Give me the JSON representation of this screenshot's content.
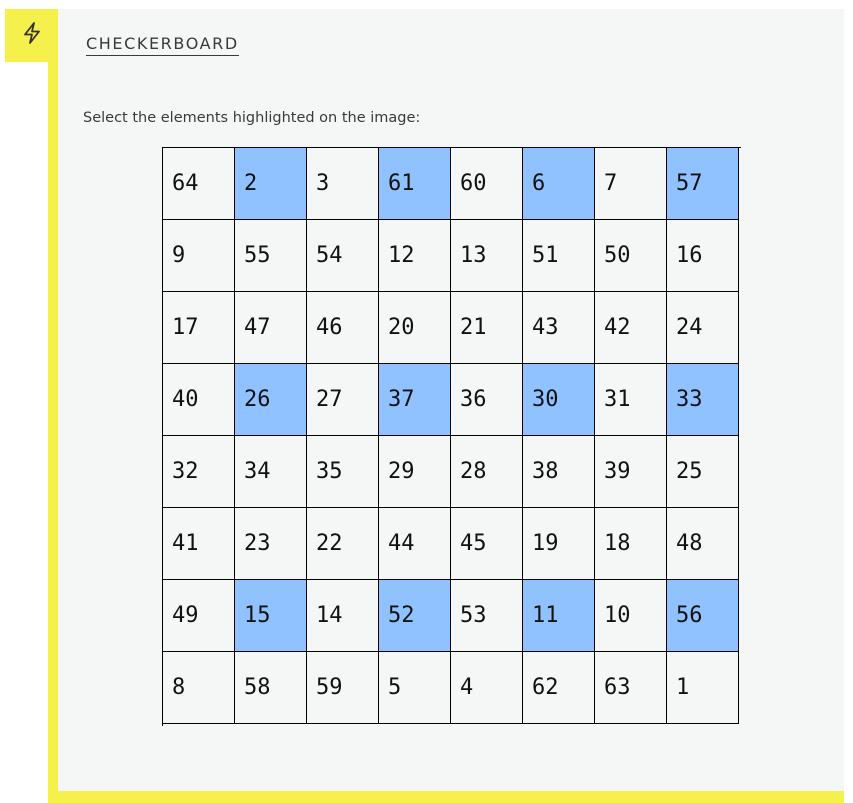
{
  "task": {
    "title": "CHECKERBOARD",
    "instruction": "Select the elements highlighted on the image:",
    "badge_icon": "lightning-bolt-icon"
  },
  "colors": {
    "accent": "#f5f04b",
    "highlight": "#8fc2ff",
    "panel": "#f5f6f6"
  },
  "board": {
    "rows": [
      [
        {
          "v": "64",
          "h": false
        },
        {
          "v": "2",
          "h": true
        },
        {
          "v": "3",
          "h": false
        },
        {
          "v": "61",
          "h": true
        },
        {
          "v": "60",
          "h": false
        },
        {
          "v": "6",
          "h": true
        },
        {
          "v": "7",
          "h": false
        },
        {
          "v": "57",
          "h": true
        }
      ],
      [
        {
          "v": "9",
          "h": false
        },
        {
          "v": "55",
          "h": false
        },
        {
          "v": "54",
          "h": false
        },
        {
          "v": "12",
          "h": false
        },
        {
          "v": "13",
          "h": false
        },
        {
          "v": "51",
          "h": false
        },
        {
          "v": "50",
          "h": false
        },
        {
          "v": "16",
          "h": false
        }
      ],
      [
        {
          "v": "17",
          "h": false
        },
        {
          "v": "47",
          "h": false
        },
        {
          "v": "46",
          "h": false
        },
        {
          "v": "20",
          "h": false
        },
        {
          "v": "21",
          "h": false
        },
        {
          "v": "43",
          "h": false
        },
        {
          "v": "42",
          "h": false
        },
        {
          "v": "24",
          "h": false
        }
      ],
      [
        {
          "v": "40",
          "h": false
        },
        {
          "v": "26",
          "h": true
        },
        {
          "v": "27",
          "h": false
        },
        {
          "v": "37",
          "h": true
        },
        {
          "v": "36",
          "h": false
        },
        {
          "v": "30",
          "h": true
        },
        {
          "v": "31",
          "h": false
        },
        {
          "v": "33",
          "h": true
        }
      ],
      [
        {
          "v": "32",
          "h": false
        },
        {
          "v": "34",
          "h": false
        },
        {
          "v": "35",
          "h": false
        },
        {
          "v": "29",
          "h": false
        },
        {
          "v": "28",
          "h": false
        },
        {
          "v": "38",
          "h": false
        },
        {
          "v": "39",
          "h": false
        },
        {
          "v": "25",
          "h": false
        }
      ],
      [
        {
          "v": "41",
          "h": false
        },
        {
          "v": "23",
          "h": false
        },
        {
          "v": "22",
          "h": false
        },
        {
          "v": "44",
          "h": false
        },
        {
          "v": "45",
          "h": false
        },
        {
          "v": "19",
          "h": false
        },
        {
          "v": "18",
          "h": false
        },
        {
          "v": "48",
          "h": false
        }
      ],
      [
        {
          "v": "49",
          "h": false
        },
        {
          "v": "15",
          "h": true
        },
        {
          "v": "14",
          "h": false
        },
        {
          "v": "52",
          "h": true
        },
        {
          "v": "53",
          "h": false
        },
        {
          "v": "11",
          "h": true
        },
        {
          "v": "10",
          "h": false
        },
        {
          "v": "56",
          "h": true
        }
      ],
      [
        {
          "v": "8",
          "h": false
        },
        {
          "v": "58",
          "h": false
        },
        {
          "v": "59",
          "h": false
        },
        {
          "v": "5",
          "h": false
        },
        {
          "v": "4",
          "h": false
        },
        {
          "v": "62",
          "h": false
        },
        {
          "v": "63",
          "h": false
        },
        {
          "v": "1",
          "h": false
        }
      ]
    ]
  }
}
